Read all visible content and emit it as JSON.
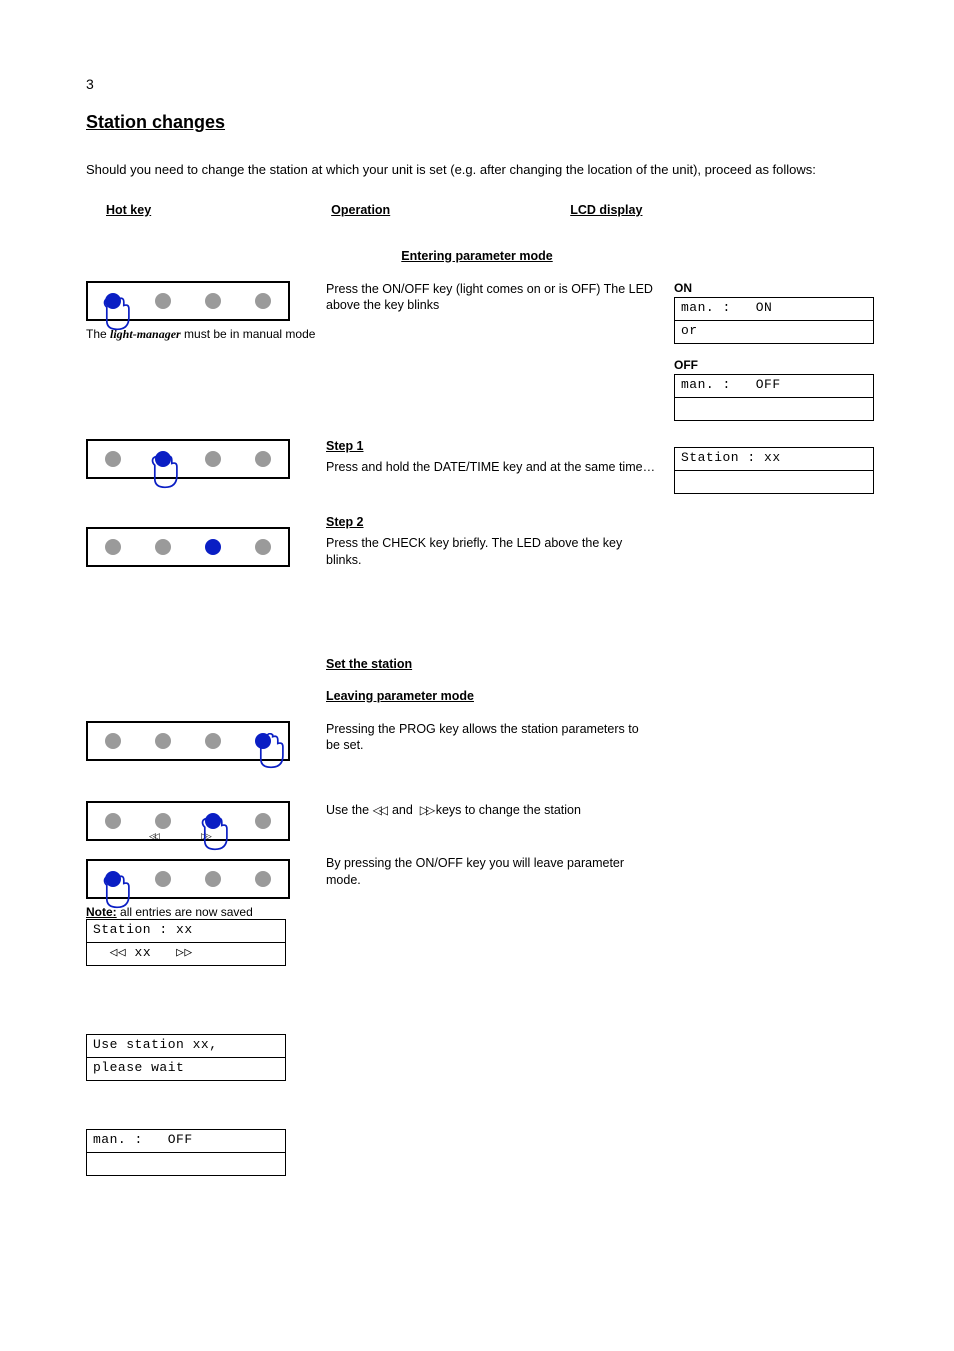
{
  "page_number": "3",
  "title": "Station changes",
  "intro": "Should you need to change the station at which your unit is set (e.g. after changing the location of the unit), proceed as follows:",
  "columns": {
    "hotkey": "Hot key",
    "operation": "Operation",
    "lcd": "LCD display"
  },
  "section_heading_1": "Entering parameter mode",
  "step1": {
    "panel_caption_prefix": "The ",
    "panel_caption_brand": "light-manager",
    "panel_caption_suffix": " must be in manual mode",
    "op_text": "Press the ON/OFF key (light comes on or is OFF) The LED above the key blinks",
    "lcd_on": {
      "label": "ON",
      "line1": "man. :   ON",
      "line2": "or"
    },
    "lcd_off": {
      "label": "OFF",
      "line1": "man. :   OFF",
      "line2": ""
    }
  },
  "step2": {
    "label": "Step 1",
    "op_text": "Press and hold the DATE/TIME key and at the same time…",
    "label2": "Step 2",
    "op_text2": "Press the CHECK key briefly. The LED above the key blinks.",
    "lcd": {
      "line1": "Station : xx",
      "line2": ""
    }
  },
  "section_heading_2": "Set the station",
  "section_heading_3": "Leaving parameter mode",
  "step3": {
    "op_text": "Pressing the PROG key allows the station parameters to be set.",
    "op_text_rw": "Use the ◁◁ and ▷▷ keys to change the station",
    "op_text_exit": "By pressing the ON/OFF key you will leave parameter mode.",
    "note_label": "Note:",
    "note_text": "all entries are now saved",
    "lcd_station": {
      "line1": "Station : xx",
      "line2": "  ◁◁ xx   ▷▷"
    },
    "lcd_hint": {
      "line1": "Use station xx,",
      "line2": "please wait"
    },
    "lcd_final": {
      "line1": "man. :   OFF",
      "line2": ""
    }
  }
}
